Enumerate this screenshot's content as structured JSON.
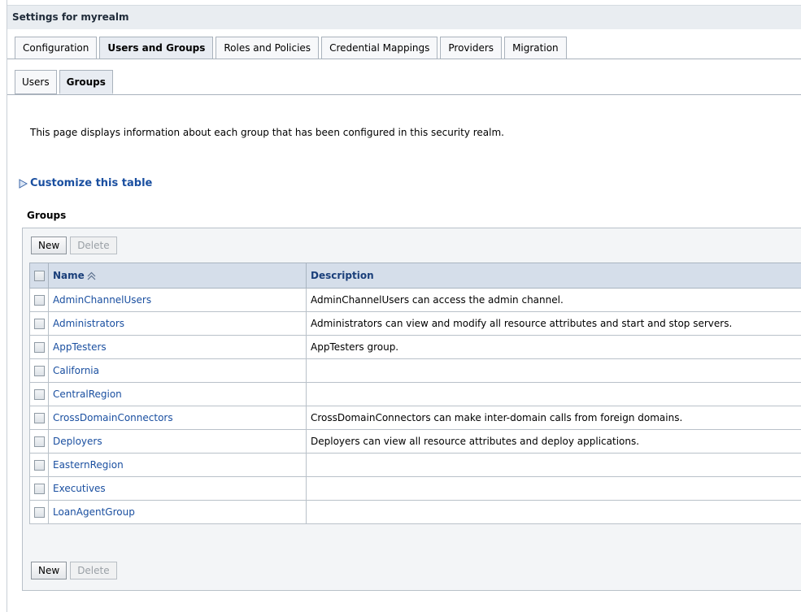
{
  "header": {
    "title": "Settings for myrealm"
  },
  "tabs": [
    {
      "label": "Configuration",
      "active": false
    },
    {
      "label": "Users and Groups",
      "active": true
    },
    {
      "label": "Roles and Policies",
      "active": false
    },
    {
      "label": "Credential Mappings",
      "active": false
    },
    {
      "label": "Providers",
      "active": false
    },
    {
      "label": "Migration",
      "active": false
    }
  ],
  "subtabs": [
    {
      "label": "Users",
      "active": false
    },
    {
      "label": "Groups",
      "active": true
    }
  ],
  "description": "This page displays information about each group that has been configured in this security realm.",
  "customize_label": "Customize this table",
  "table_title": "Groups",
  "buttons": {
    "new": "New",
    "delete": "Delete"
  },
  "columns": {
    "name": "Name",
    "description": "Description"
  },
  "rows": [
    {
      "name": "AdminChannelUsers",
      "description": "AdminChannelUsers can access the admin channel."
    },
    {
      "name": "Administrators",
      "description": "Administrators can view and modify all resource attributes and start and stop servers."
    },
    {
      "name": "AppTesters",
      "description": "AppTesters group."
    },
    {
      "name": "California",
      "description": ""
    },
    {
      "name": "CentralRegion",
      "description": ""
    },
    {
      "name": "CrossDomainConnectors",
      "description": "CrossDomainConnectors can make inter-domain calls from foreign domains."
    },
    {
      "name": "Deployers",
      "description": "Deployers can view all resource attributes and deploy applications."
    },
    {
      "name": "EasternRegion",
      "description": ""
    },
    {
      "name": "Executives",
      "description": ""
    },
    {
      "name": "LoanAgentGroup",
      "description": ""
    }
  ],
  "icons": {
    "customize": "expand-triangle-icon",
    "sort": "sort-ascending-icon"
  },
  "colors": {
    "link": "#1a4fa0",
    "header_bg": "#e9edf1",
    "table_header_bg": "#d5deea"
  }
}
